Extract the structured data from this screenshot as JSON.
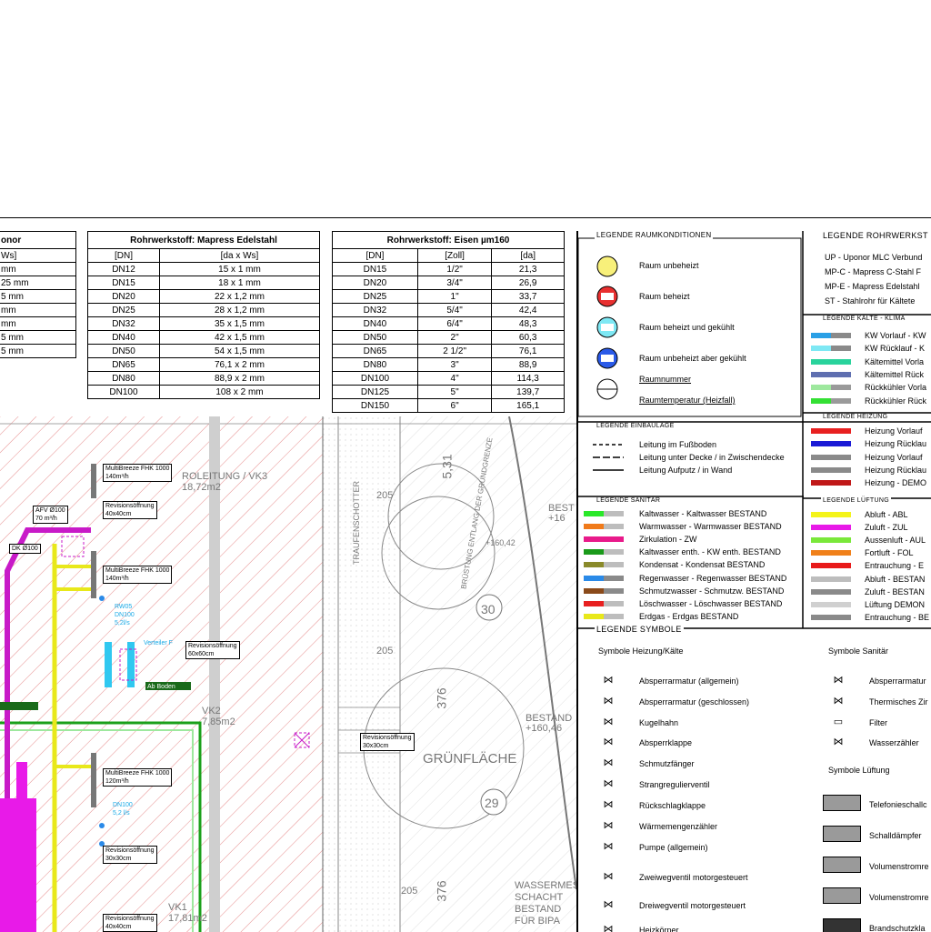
{
  "table_left": {
    "title": "onor",
    "subtitle": "Ws]",
    "rows": [
      "mm",
      "25 mm",
      "5 mm",
      "mm",
      "mm",
      "5 mm",
      "5 mm"
    ]
  },
  "table_mapress": {
    "title": "Rohrwerkstoff: Mapress Edelstahl",
    "headers": [
      "[DN]",
      "[da x Ws]"
    ],
    "rows": [
      [
        "DN12",
        "15 x 1 mm"
      ],
      [
        "DN15",
        "18 x 1 mm"
      ],
      [
        "DN20",
        "22 x 1,2 mm"
      ],
      [
        "DN25",
        "28 x 1,2 mm"
      ],
      [
        "DN32",
        "35 x 1,5 mm"
      ],
      [
        "DN40",
        "42 x 1,5 mm"
      ],
      [
        "DN50",
        "54 x 1,5 mm"
      ],
      [
        "DN65",
        "76,1 x 2 mm"
      ],
      [
        "DN80",
        "88,9 x 2 mm"
      ],
      [
        "DN100",
        "108 x 2 mm"
      ]
    ]
  },
  "table_eisen": {
    "title": "Rohrwerkstoff: Eisen µm160",
    "headers": [
      "[DN]",
      "[Zoll]",
      "[da]"
    ],
    "rows": [
      [
        "DN15",
        "1/2\"",
        "21,3"
      ],
      [
        "DN20",
        "3/4\"",
        "26,9"
      ],
      [
        "DN25",
        "1\"",
        "33,7"
      ],
      [
        "DN32",
        "5/4\"",
        "42,4"
      ],
      [
        "DN40",
        "6/4\"",
        "48,3"
      ],
      [
        "DN50",
        "2\"",
        "60,3"
      ],
      [
        "DN65",
        "2 1/2\"",
        "76,1"
      ],
      [
        "DN80",
        "3\"",
        "88,9"
      ],
      [
        "DN100",
        "4\"",
        "114,3"
      ],
      [
        "DN125",
        "5\"",
        "139,7"
      ],
      [
        "DN150",
        "6\"",
        "165,1"
      ]
    ]
  },
  "legend_raum": {
    "title": "LEGENDE RAUMKONDITIONEN",
    "items": [
      "Raum unbeheizt",
      "Raum beheizt",
      "Raum beheizt und gekühlt",
      "Raum unbeheizt aber gekühlt",
      "Raumnummer",
      "Raumtemperatur (Heizfall)"
    ]
  },
  "legend_rohr": {
    "title": "LEGENDE ROHRWERKST",
    "items": [
      "UP - Uponor MLC Verbund",
      "MP-C - Mapress C-Stahl F",
      "MP-E - Mapress Edelstahl",
      "ST - Stahlrohr für Kältete"
    ]
  },
  "legend_kaelte": {
    "title": "LEGENDE KÄLTE - KLIMA",
    "items": [
      {
        "text": "KW Vorlauf - KW",
        "c1": "#2aa0e6",
        "c2": "#8a8a8a"
      },
      {
        "text": "KW Rücklauf - K",
        "c1": "#7ee8f4",
        "c2": "#8a8a8a"
      },
      {
        "text": "Kältemittel Vorla",
        "c1": "#29d39c",
        "c2": "#29d39c"
      },
      {
        "text": "Kältemittel Rück",
        "c1": "#5f6fb0",
        "c2": "#5f6fb0"
      },
      {
        "text": "Rückkühler Vorla",
        "c1": "#9ee89e",
        "c2": "#9a9a9a"
      },
      {
        "text": "Rückkühler Rück",
        "c1": "#34e034",
        "c2": "#9a9a9a"
      }
    ]
  },
  "legend_heizung": {
    "title": "LEGENDE HEIZUNG",
    "items": [
      {
        "text": "Heizung Vorlauf",
        "c1": "#e82020",
        "c2": "#e82020"
      },
      {
        "text": "Heizung Rücklau",
        "c1": "#1a1ad6",
        "c2": "#1a1ad6"
      },
      {
        "text": "Heizung Vorlauf",
        "c1": "#8a8a8a",
        "c2": "#8a8a8a"
      },
      {
        "text": "Heizung Rücklau",
        "c1": "#8a8a8a",
        "c2": "#8a8a8a"
      },
      {
        "text": "Heizung - DEMO",
        "c1": "#c01818",
        "c2": "#c01818"
      }
    ]
  },
  "legend_einbau": {
    "title": "LEGENDE EINBAULAGE",
    "items": [
      "Leitung im Fußboden",
      "Leitung unter Decke / in Zwischendecke",
      "Leitung Aufputz / in Wand"
    ]
  },
  "legend_sanitaer": {
    "title": "LEGENDE SANITÄR",
    "items": [
      {
        "text": "Kaltwasser - Kaltwasser BESTAND",
        "c1": "#29e829",
        "c2": "#bdbdbd"
      },
      {
        "text": "Warmwasser - Warmwasser BESTAND",
        "c1": "#f07a1a",
        "c2": "#bdbdbd"
      },
      {
        "text": "Zirkulation - ZW",
        "c1": "#e81a8a",
        "c2": "#e81a8a"
      },
      {
        "text": "Kaltwasser enth. - KW enth. BESTAND",
        "c1": "#1a9a1a",
        "c2": "#bdbdbd"
      },
      {
        "text": "Kondensat - Kondensat BESTAND",
        "c1": "#8a8a2a",
        "c2": "#bdbdbd"
      },
      {
        "text": "Regenwasser - Regenwasser BESTAND",
        "c1": "#2a8ae8",
        "c2": "#8a8a8a"
      },
      {
        "text": "Schmutzwasser - Schmutzw. BESTAND",
        "c1": "#8a4a1a",
        "c2": "#8a8a8a"
      },
      {
        "text": "Löschwasser - Löschwasser BESTAND",
        "c1": "#e82020",
        "c2": "#bdbdbd"
      },
      {
        "text": "Erdgas - Erdgas BESTAND",
        "c1": "#e8e81a",
        "c2": "#bdbdbd"
      }
    ]
  },
  "legend_lueftung": {
    "title": "LEGENDE LÜFTUNG",
    "items": [
      {
        "text": "Abluft - ABL",
        "c1": "#f4f41a"
      },
      {
        "text": "Zuluft - ZUL",
        "c1": "#e81ae8"
      },
      {
        "text": "Aussenluft - AUL",
        "c1": "#7ae83a"
      },
      {
        "text": "Fortluft - FOL",
        "c1": "#f0801a"
      },
      {
        "text": "Entrauchung - E",
        "c1": "#e81a1a"
      },
      {
        "text": "Abluft - BESTAN",
        "c1": "#bdbdbd"
      },
      {
        "text": "Zuluft - BESTAN",
        "c1": "#8a8a8a"
      },
      {
        "text": "Lüftung DEMON",
        "c1": "#d0d0d0"
      },
      {
        "text": "Entrauchung - BE",
        "c1": "#8a8a8a"
      }
    ]
  },
  "legend_symbole": {
    "title": "LEGENDE SYMBOLE",
    "heading_heizung": "Symbole Heizung/Kälte",
    "heading_sanitaer": "Symbole Sanitär",
    "heading_lueftung": "Symbole Lüftung",
    "heizung": [
      "Absperrarmatur (allgemein)",
      "Absperrarmatur (geschlossen)",
      "Kugelhahn",
      "Absperrklappe",
      "Schmutzfänger",
      "Strangregulierventil",
      "Rückschlagklappe",
      "Wärmemengenzähler",
      "Pumpe (allgemein)",
      "Zweiwegventil motorgesteuert",
      "Dreiwegventil motorgesteuert",
      "Heizkörper"
    ],
    "sanitaer": [
      "Absperrarmatur",
      "Thermisches Zir",
      "Filter",
      "Wasserzähler"
    ],
    "lueftung": [
      "Telefonieschallc",
      "Schalldämpfer",
      "Volumenstromre",
      "Volumenstromre",
      "Brandschutzkla"
    ]
  },
  "plan": {
    "labels": [
      {
        "id": "mb1",
        "text": "MultiBreeze FHK 1000",
        "sub": "140m³/h"
      },
      {
        "id": "rev1",
        "text": "Revisionsöffnung",
        "sub": "40x40cm"
      },
      {
        "id": "mb2",
        "text": "MultiBreeze FHK 1000",
        "sub": "140m³/h"
      },
      {
        "id": "rev2",
        "text": "Revisionsöffnung",
        "sub": "60x60cm"
      },
      {
        "id": "rev3",
        "text": "Revisionsöffnung",
        "sub": "30x30cm"
      },
      {
        "id": "mb3",
        "text": "MultiBreeze FHK 1000",
        "sub": "120m³/h"
      },
      {
        "id": "rev4",
        "text": "Revisionsöffnung",
        "sub": "30x30cm"
      },
      {
        "id": "rev5",
        "text": "Revisionsöffnung",
        "sub": "40x40cm"
      },
      {
        "id": "afv",
        "text": "AFV Ø100",
        "sub": "70 m³/h"
      },
      {
        "id": "dk",
        "text": "DK Ø100",
        "sub": ""
      }
    ],
    "texts": {
      "grunflache": "GRÜNFLÄCHE",
      "bestand1": "BESTAND",
      "bestand1_h": "+160,46",
      "bestand2": "BEST",
      "bestand2_h": "+16",
      "wassermes": "WASSERMES",
      "schacht": "SCHACHT",
      "bestand3": "BESTAND",
      "fur_bipa": "FÜR BIPA",
      "vk3": "ROLEITUNG / VK3",
      "vk3_area": "18,72m2",
      "vk2": "VK2",
      "vk2_area": "7,85m2",
      "vk1": "VK1",
      "vk1_area": "17,81m2",
      "h1": "+160,42",
      "n531": "5,31",
      "n376a": "376",
      "n376b": "376",
      "n205a": "205",
      "n205b": "205",
      "n205c": "205",
      "n30": "30",
      "n29": "29",
      "trauf": "TRAUFENSCHOTTER",
      "grenze": "BRÜSTUNG ENTLANG DER GRUNDGRENZE",
      "rw": "RW05",
      "dn": "DN100",
      "rw_sub": "5,2l/s",
      "dn2": "DN100",
      "dn2_sub": "5,2 l/s",
      "verteiler": "Verteiler F",
      "ab": "Ab Boden"
    }
  }
}
